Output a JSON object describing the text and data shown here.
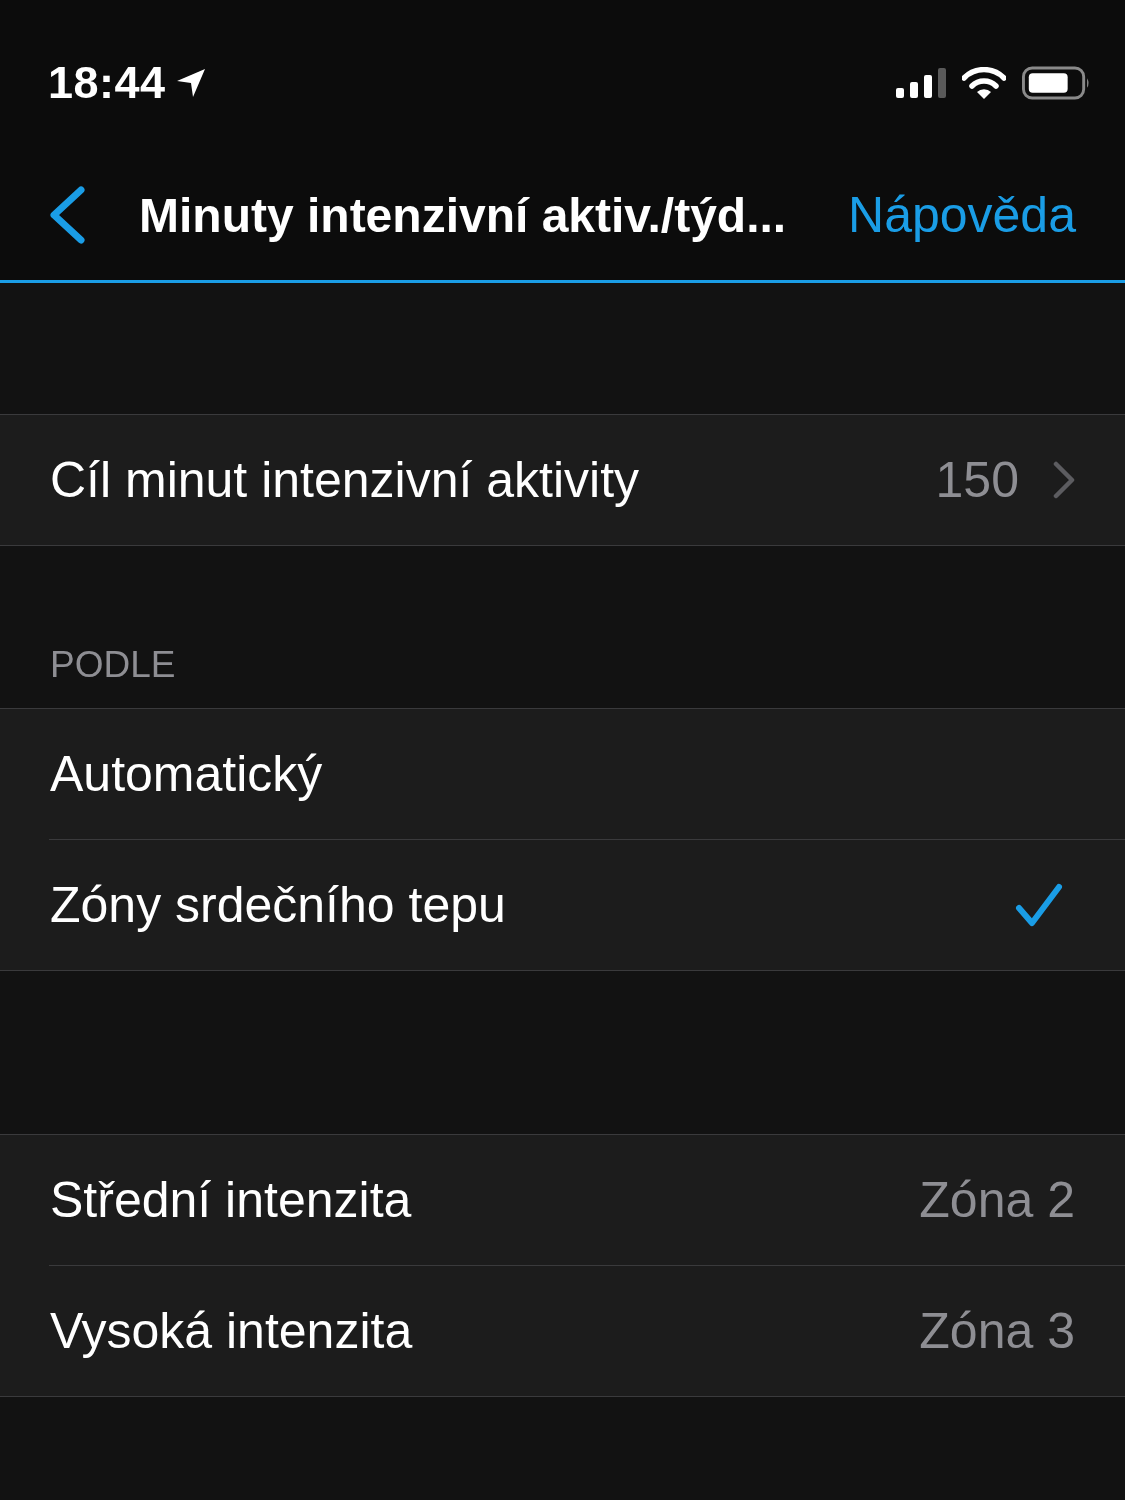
{
  "status_bar": {
    "time": "18:44"
  },
  "nav_bar": {
    "title": "Minuty intenzivní aktiv./týd...",
    "action": "Nápověda"
  },
  "goal_section": {
    "rows": [
      {
        "label": "Cíl minut intenzivní aktivity",
        "value": "150"
      }
    ]
  },
  "method_section": {
    "header": "PODLE",
    "options": [
      {
        "label": "Automatický",
        "selected": false
      },
      {
        "label": "Zóny srdečního tepu",
        "selected": true
      }
    ]
  },
  "intensity_section": {
    "rows": [
      {
        "label": "Střední intenzita",
        "value": "Zóna 2"
      },
      {
        "label": "Vysoká intenzita",
        "value": "Zóna 3"
      }
    ]
  }
}
